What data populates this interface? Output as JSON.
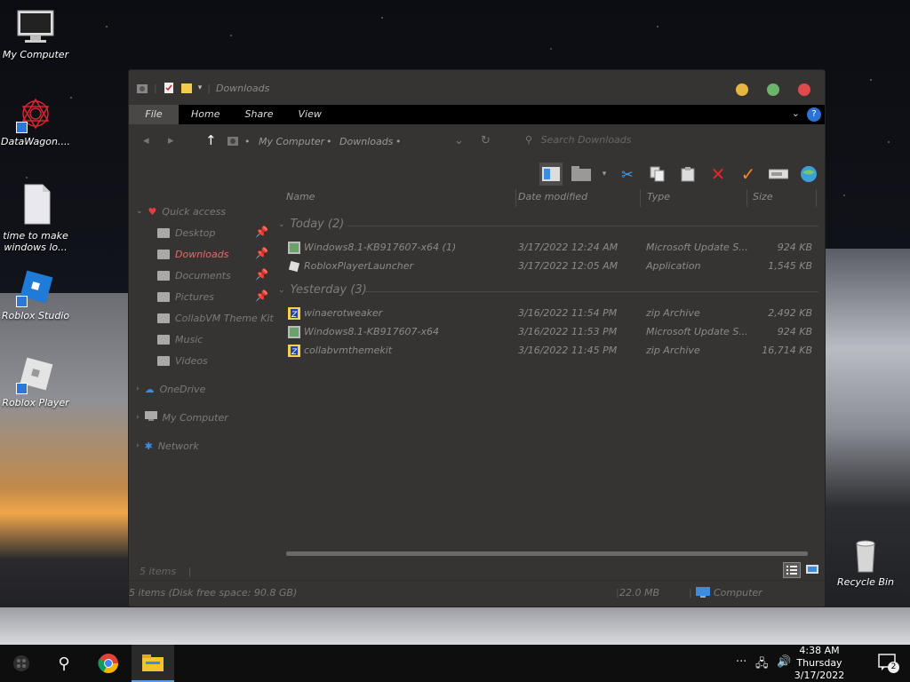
{
  "desktop": {
    "icons": [
      {
        "label": "My Computer"
      },
      {
        "label": "DataWagon...."
      },
      {
        "label": "time to make windows lo..."
      },
      {
        "label": "Roblox Studio"
      },
      {
        "label": "Roblox Player"
      },
      {
        "label": "Recycle Bin"
      }
    ]
  },
  "window": {
    "title": "Downloads",
    "ribbon_tabs": [
      "File",
      "Home",
      "Share",
      "View"
    ],
    "help_label": "?",
    "address": {
      "crumbs": [
        "My Computer",
        "Downloads"
      ],
      "search_placeholder": "Search Downloads"
    },
    "columns": {
      "name": "Name",
      "date": "Date modified",
      "type": "Type",
      "size": "Size"
    },
    "sidebar": {
      "quick_access": "Quick access",
      "items": [
        {
          "label": "Desktop",
          "pinned": true
        },
        {
          "label": "Downloads",
          "pinned": true,
          "active": true
        },
        {
          "label": "Documents",
          "pinned": true
        },
        {
          "label": "Pictures",
          "pinned": true
        },
        {
          "label": "CollabVM Theme Kit",
          "pinned": false
        },
        {
          "label": "Music",
          "pinned": false
        },
        {
          "label": "Videos",
          "pinned": false
        }
      ],
      "onedrive": "OneDrive",
      "my_computer": "My Computer",
      "network": "Network"
    },
    "groups": [
      {
        "label": "Today (2)",
        "files": [
          {
            "name": "Windows8.1-KB917607-x64 (1)",
            "date": "3/17/2022 12:24 AM",
            "type": "Microsoft Update S...",
            "size": "924 KB"
          },
          {
            "name": "RobloxPlayerLauncher",
            "date": "3/17/2022 12:05 AM",
            "type": "Application",
            "size": "1,545 KB"
          }
        ]
      },
      {
        "label": "Yesterday (3)",
        "files": [
          {
            "name": "winaerotweaker",
            "date": "3/16/2022 11:54 PM",
            "type": "zip Archive",
            "size": "2,492 KB"
          },
          {
            "name": "Windows8.1-KB917607-x64",
            "date": "3/16/2022 11:53 PM",
            "type": "Microsoft Update S...",
            "size": "924 KB"
          },
          {
            "name": "collabvmthemekit",
            "date": "3/16/2022 11:45 PM",
            "type": "zip Archive",
            "size": "16,714 KB"
          }
        ]
      }
    ],
    "status": {
      "items_count": "5 items",
      "detail": "5 items (Disk free space: 90.8 GB)",
      "selected_size": "22.0 MB",
      "location": "Computer"
    }
  },
  "taskbar": {
    "time": "4:38 AM",
    "day": "Thursday",
    "date": "3/17/2022",
    "notification_count": "2"
  }
}
